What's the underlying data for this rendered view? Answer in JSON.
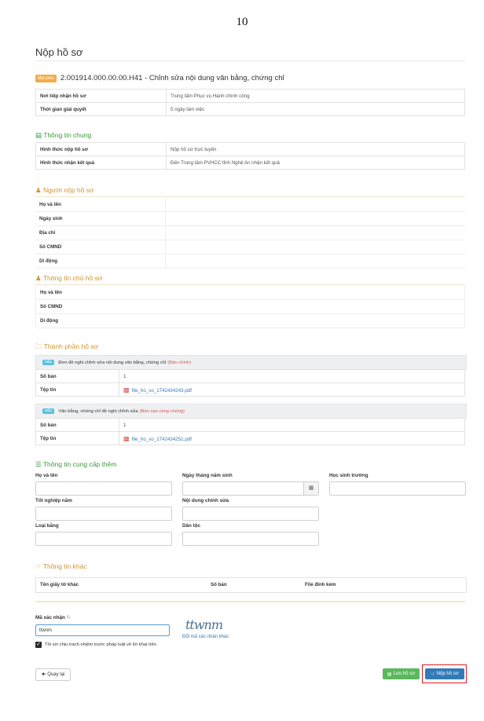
{
  "page_number": "10",
  "page_title": "Nộp hồ sơ",
  "procedure": {
    "tag": "Một phần",
    "code_title": "2.001914.000.00.00.H41 - Chỉnh sửa nội dung văn bằng, chứng chỉ"
  },
  "info_rows": [
    {
      "label": "Nơi tiếp nhận hồ sơ",
      "value": "Trung tâm Phục vụ Hành chính công"
    },
    {
      "label": "Thời gian giải quyết",
      "value": "5 ngày làm việc"
    }
  ],
  "general": {
    "heading": "Thông tin chung",
    "rows": [
      {
        "label": "Hình thức nộp hồ sơ",
        "value": "Nộp hồ sơ trực tuyến"
      },
      {
        "label": "Hình thức nhận kết quả",
        "value": "Đến Trung tâm PVHCC tỉnh Nghệ An nhận kết quả"
      }
    ]
  },
  "submitter": {
    "heading": "Người nộp hồ sơ",
    "rows": [
      "Họ và tên",
      "Ngày sinh",
      "Địa chỉ",
      "Số CMND",
      "Di động"
    ]
  },
  "owner": {
    "heading": "Thông tin chủ hồ sơ",
    "rows": [
      "Họ và tên",
      "Số CMND",
      "Di động"
    ]
  },
  "components": {
    "heading": "Thành phần hồ sơ",
    "docs": [
      {
        "badge": "Mẫu",
        "name": "Đơn đề nghị chỉnh sửa nội dung văn bằng, chứng chỉ",
        "note": "(Bản chính)",
        "copies_label": "Số bản",
        "copies": "1",
        "file_label": "Tệp tin",
        "file": "file_ho_so_1742434243.pdf"
      },
      {
        "badge": "Mẫu",
        "name": "Văn bằng, chứng chỉ đề nghị chỉnh sửa",
        "note": "(Bản sao công chứng)",
        "copies_label": "Số bản",
        "copies": "1",
        "file_label": "Tệp tin",
        "file": "file_ho_so_1742434251.pdf"
      }
    ]
  },
  "extra": {
    "heading": "Thông tin cung cấp thêm",
    "fields": {
      "full_name": "Họ và tên",
      "birth_date": "Ngày tháng năm sinh",
      "school": "Học sinh trường",
      "grad_year": "Tốt nghiệp năm",
      "edit_content": "Nội dung chỉnh sửa",
      "rank": "Loại bằng",
      "ethnicity": "Dân tộc"
    }
  },
  "other": {
    "heading": "Thông tin khác",
    "columns": [
      "Tên giấy tờ khác",
      "Số bản",
      "File đính kèm"
    ]
  },
  "captcha": {
    "label": "Mã xác nhận",
    "value": "ttwnm",
    "image_text": "ttwnm",
    "refresh": "Đổi mã xác nhận khác"
  },
  "agree_text": "Tôi xin chịu trách nhiệm trước pháp luật về lời khai trên",
  "buttons": {
    "back": "Quay lại",
    "save": "Lưu hồ sơ",
    "submit": "Nộp hồ sơ"
  },
  "colors": {
    "green": "#3c9a3c",
    "orange": "#d4932a",
    "primary": "#337ab7",
    "save": "#5cb85c",
    "highlight": "#e31b23"
  }
}
